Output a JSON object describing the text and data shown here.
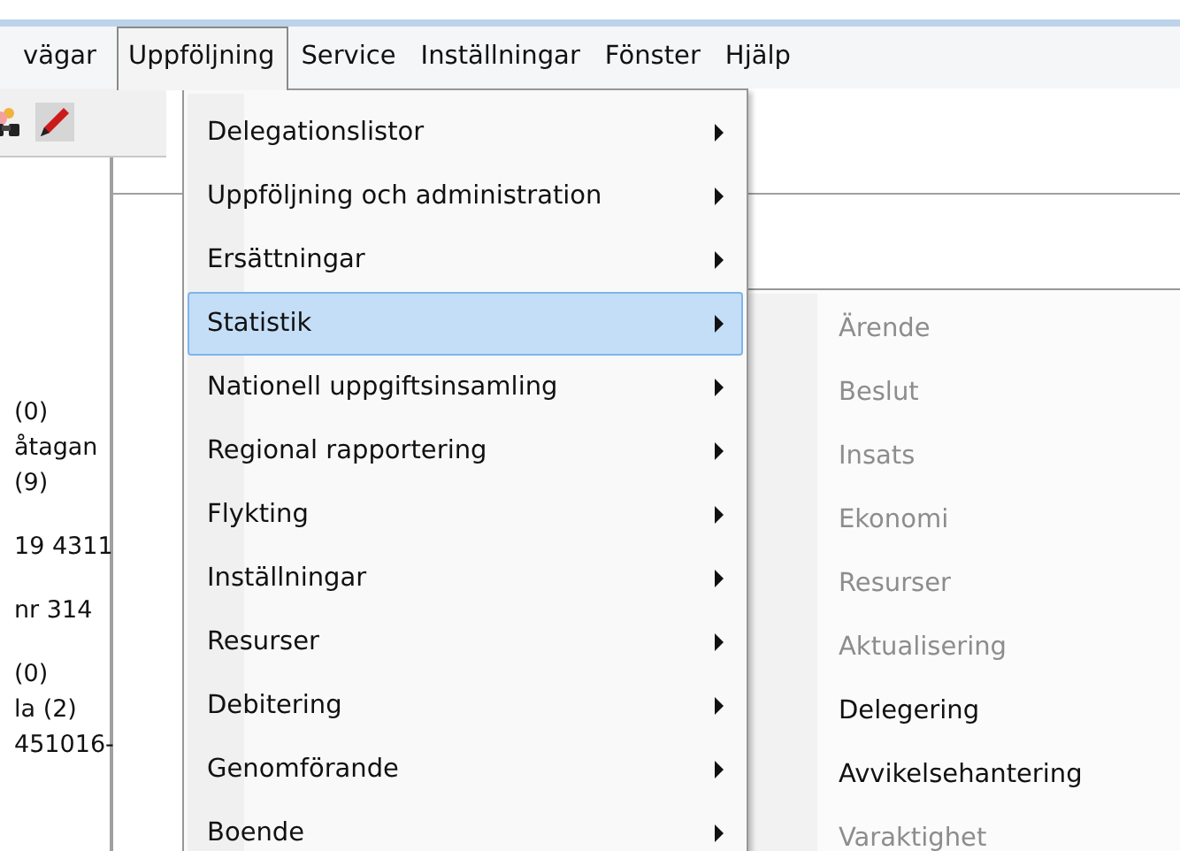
{
  "menu_bar": [
    {
      "label": "vägar",
      "open": false
    },
    {
      "label": "Uppföljning",
      "open": true
    },
    {
      "label": "Service",
      "open": false
    },
    {
      "label": "Inställningar",
      "open": false
    },
    {
      "label": "Fönster",
      "open": false
    },
    {
      "label": "Hjälp",
      "open": false
    }
  ],
  "toolbar": [
    {
      "kind": "binoculars"
    },
    {
      "kind": "pen"
    }
  ],
  "left_panel": [
    [
      "(0)",
      "åtagan",
      "(9)"
    ],
    [
      "19 4311"
    ],
    [
      "nr 314"
    ],
    [
      "(0)",
      "la (2)",
      "451016-"
    ]
  ],
  "menu": [
    {
      "label": "Delegationslistor",
      "selected": false,
      "has_submenu": true
    },
    {
      "label": "Uppföljning och administration",
      "selected": false,
      "has_submenu": true
    },
    {
      "label": "Ersättningar",
      "selected": false,
      "has_submenu": true
    },
    {
      "label": "Statistik",
      "selected": true,
      "has_submenu": true
    },
    {
      "label": "Nationell uppgiftsinsamling",
      "selected": false,
      "has_submenu": true
    },
    {
      "label": "Regional rapportering",
      "selected": false,
      "has_submenu": true
    },
    {
      "label": "Flykting",
      "selected": false,
      "has_submenu": true
    },
    {
      "label": "Inställningar",
      "selected": false,
      "has_submenu": true
    },
    {
      "label": "Resurser",
      "selected": false,
      "has_submenu": true
    },
    {
      "label": "Debitering",
      "selected": false,
      "has_submenu": true
    },
    {
      "label": "Genomförande",
      "selected": false,
      "has_submenu": true
    },
    {
      "label": "Boende",
      "selected": false,
      "has_submenu": true
    }
  ],
  "submenu": [
    {
      "label": "Ärende",
      "disabled": true
    },
    {
      "label": "Beslut",
      "disabled": true
    },
    {
      "label": "Insats",
      "disabled": true
    },
    {
      "label": "Ekonomi",
      "disabled": true
    },
    {
      "label": "Resurser",
      "disabled": true
    },
    {
      "label": "Aktualisering",
      "disabled": true
    },
    {
      "label": "Delegering",
      "disabled": false
    },
    {
      "label": "Avvikelsehantering",
      "disabled": false
    },
    {
      "label": "Varaktighet",
      "disabled": true
    }
  ]
}
